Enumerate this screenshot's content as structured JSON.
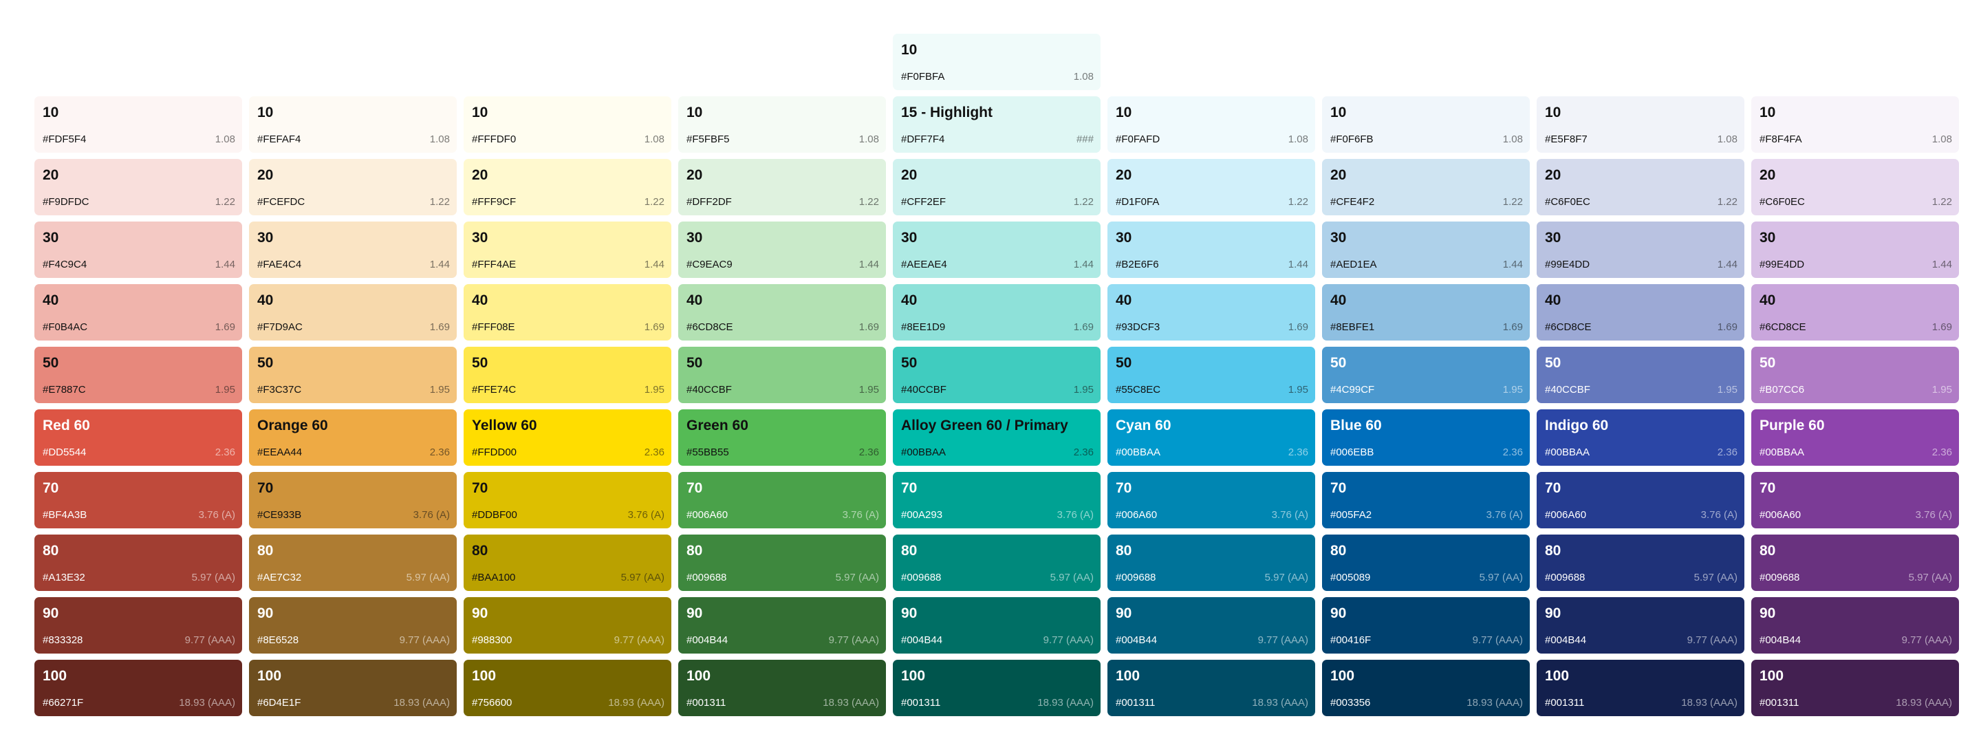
{
  "columns": [
    {
      "name": "red",
      "swatches": [
        {
          "label": "10",
          "hex": "#FDF5F4",
          "contrast": "1.08",
          "fill": "#FDF5F4"
        },
        {
          "label": "20",
          "hex": "#F9DFDC",
          "contrast": "1.22",
          "fill": "#F9DFDC"
        },
        {
          "label": "30",
          "hex": "#F4C9C4",
          "contrast": "1.44",
          "fill": "#F4C9C4"
        },
        {
          "label": "40",
          "hex": "#F0B4AC",
          "contrast": "1.69",
          "fill": "#F0B4AC"
        },
        {
          "label": "50",
          "hex": "#E7887C",
          "contrast": "1.95",
          "fill": "#E7887C"
        },
        {
          "label": "Red 60",
          "hex": "#DD5544",
          "contrast": "2.36",
          "fill": "#DD5544"
        },
        {
          "label": "70",
          "hex": "#BF4A3B",
          "contrast": "3.76 (A)",
          "fill": "#BF4A3B"
        },
        {
          "label": "80",
          "hex": "#A13E32",
          "contrast": "5.97 (AA)",
          "fill": "#A13E32"
        },
        {
          "label": "90",
          "hex": "#833328",
          "contrast": "9.77 (AAA)",
          "fill": "#833328"
        },
        {
          "label": "100",
          "hex": "#66271F",
          "contrast": "18.93 (AAA)",
          "fill": "#66271F"
        }
      ]
    },
    {
      "name": "orange",
      "swatches": [
        {
          "label": "10",
          "hex": "#FEFAF4",
          "contrast": "1.08",
          "fill": "#FEFAF4"
        },
        {
          "label": "20",
          "hex": "#FCEFDC",
          "contrast": "1.22",
          "fill": "#FCEFDC"
        },
        {
          "label": "30",
          "hex": "#FAE4C4",
          "contrast": "1.44",
          "fill": "#FAE4C4"
        },
        {
          "label": "40",
          "hex": "#F7D9AC",
          "contrast": "1.69",
          "fill": "#F7D9AC"
        },
        {
          "label": "50",
          "hex": "#F3C37C",
          "contrast": "1.95",
          "fill": "#F3C37C"
        },
        {
          "label": "Orange 60",
          "hex": "#EEAA44",
          "contrast": "2.36",
          "fill": "#EEAA44"
        },
        {
          "label": "70",
          "hex": "#CE933B",
          "contrast": "3.76 (A)",
          "fill": "#CE933B"
        },
        {
          "label": "80",
          "hex": "#AE7C32",
          "contrast": "5.97 (AA)",
          "fill": "#AE7C32"
        },
        {
          "label": "90",
          "hex": "#8E6528",
          "contrast": "9.77 (AAA)",
          "fill": "#8E6528"
        },
        {
          "label": "100",
          "hex": "#6D4E1F",
          "contrast": "18.93 (AAA)",
          "fill": "#6D4E1F"
        }
      ]
    },
    {
      "name": "yellow",
      "swatches": [
        {
          "label": "10",
          "hex": "#FFFDF0",
          "contrast": "1.08",
          "fill": "#FFFDF0"
        },
        {
          "label": "20",
          "hex": "#FFF9CF",
          "contrast": "1.22",
          "fill": "#FFF9CF"
        },
        {
          "label": "30",
          "hex": "#FFF4AE",
          "contrast": "1.44",
          "fill": "#FFF4AE"
        },
        {
          "label": "40",
          "hex": "#FFF08E",
          "contrast": "1.69",
          "fill": "#FFF08E"
        },
        {
          "label": "50",
          "hex": "#FFE74C",
          "contrast": "1.95",
          "fill": "#FFE74C"
        },
        {
          "label": "Yellow 60",
          "hex": "#FFDD00",
          "contrast": "2.36",
          "fill": "#FFDD00"
        },
        {
          "label": "70",
          "hex": "#DDBF00",
          "contrast": "3.76 (A)",
          "fill": "#DDBF00"
        },
        {
          "label": "80",
          "hex": "#BAA100",
          "contrast": "5.97 (AA)",
          "fill": "#BAA100"
        },
        {
          "label": "90",
          "hex": "#988300",
          "contrast": "9.77 (AAA)",
          "fill": "#988300"
        },
        {
          "label": "100",
          "hex": "#756600",
          "contrast": "18.93 (AAA)",
          "fill": "#756600"
        }
      ]
    },
    {
      "name": "green",
      "swatches": [
        {
          "label": "10",
          "hex": "#F5FBF5",
          "contrast": "1.08",
          "fill": "#F5FBF5"
        },
        {
          "label": "20",
          "hex": "#DFF2DF",
          "contrast": "1.22",
          "fill": "#DFF2DF"
        },
        {
          "label": "30",
          "hex": "#C9EAC9",
          "contrast": "1.44",
          "fill": "#C9EAC9"
        },
        {
          "label": "40",
          "hex": "#6CD8CE",
          "contrast": "1.69",
          "fill": "#B3E1B3"
        },
        {
          "label": "50",
          "hex": "#40CCBF",
          "contrast": "1.95",
          "fill": "#88CF88"
        },
        {
          "label": "Green 60",
          "hex": "#55BB55",
          "contrast": "2.36",
          "fill": "#55BB55"
        },
        {
          "label": "70",
          "hex": "#006A60",
          "contrast": "3.76 (A)",
          "fill": "#4AA24A"
        },
        {
          "label": "80",
          "hex": "#009688",
          "contrast": "5.97 (AA)",
          "fill": "#3E883E"
        },
        {
          "label": "90",
          "hex": "#004B44",
          "contrast": "9.77 (AAA)",
          "fill": "#336F33"
        },
        {
          "label": "100",
          "hex": "#001311",
          "contrast": "18.93 (AAA)",
          "fill": "#275527"
        }
      ]
    },
    {
      "name": "alloy-green",
      "top": {
        "label": "10",
        "hex": "#F0FBFA",
        "contrast": "1.08",
        "fill": "#F0FBFA"
      },
      "swatches": [
        {
          "label": "15 - Highlight",
          "hex": "#DFF7F4",
          "contrast": "###",
          "fill": "#DFF7F4"
        },
        {
          "label": "20",
          "hex": "#CFF2EF",
          "contrast": "1.22",
          "fill": "#CFF2EF"
        },
        {
          "label": "30",
          "hex": "#AEEAE4",
          "contrast": "1.44",
          "fill": "#AEEAE4"
        },
        {
          "label": "40",
          "hex": "#8EE1D9",
          "contrast": "1.69",
          "fill": "#8EE1D9"
        },
        {
          "label": "50",
          "hex": "#40CCBF",
          "contrast": "1.95",
          "fill": "#40CCBF"
        },
        {
          "label": "Alloy Green 60 / Primary",
          "hex": "#00BBAA",
          "contrast": "2.36",
          "fill": "#00BBAA"
        },
        {
          "label": "70",
          "hex": "#00A293",
          "contrast": "3.76 (A)",
          "fill": "#00A293"
        },
        {
          "label": "80",
          "hex": "#009688",
          "contrast": "5.97 (AA)",
          "fill": "#00897C"
        },
        {
          "label": "90",
          "hex": "#004B44",
          "contrast": "9.77 (AAA)",
          "fill": "#006F65"
        },
        {
          "label": "100",
          "hex": "#001311",
          "contrast": "18.93 (AAA)",
          "fill": "#00554D"
        }
      ]
    },
    {
      "name": "cyan",
      "swatches": [
        {
          "label": "10",
          "hex": "#F0FAFD",
          "contrast": "1.08",
          "fill": "#F0FAFD"
        },
        {
          "label": "20",
          "hex": "#D1F0FA",
          "contrast": "1.22",
          "fill": "#D1F0FA"
        },
        {
          "label": "30",
          "hex": "#B2E6F6",
          "contrast": "1.44",
          "fill": "#B2E6F6"
        },
        {
          "label": "40",
          "hex": "#93DCF3",
          "contrast": "1.69",
          "fill": "#93DCF3"
        },
        {
          "label": "50",
          "hex": "#55C8EC",
          "contrast": "1.95",
          "fill": "#55C8EC"
        },
        {
          "label": "Cyan 60",
          "hex": "#00BBAA",
          "contrast": "2.36",
          "fill": "#0099CC"
        },
        {
          "label": "70",
          "hex": "#006A60",
          "contrast": "3.76 (A)",
          "fill": "#0086B2"
        },
        {
          "label": "80",
          "hex": "#009688",
          "contrast": "5.97 (AA)",
          "fill": "#007399"
        },
        {
          "label": "90",
          "hex": "#004B44",
          "contrast": "9.77 (AAA)",
          "fill": "#005F7F"
        },
        {
          "label": "100",
          "hex": "#001311",
          "contrast": "18.93 (AAA)",
          "fill": "#004C66"
        }
      ]
    },
    {
      "name": "blue",
      "swatches": [
        {
          "label": "10",
          "hex": "#F0F6FB",
          "contrast": "1.08",
          "fill": "#F0F6FB"
        },
        {
          "label": "20",
          "hex": "#CFE4F2",
          "contrast": "1.22",
          "fill": "#CFE4F2"
        },
        {
          "label": "30",
          "hex": "#AED1EA",
          "contrast": "1.44",
          "fill": "#AED1EA"
        },
        {
          "label": "40",
          "hex": "#8EBFE1",
          "contrast": "1.69",
          "fill": "#8EBFE1"
        },
        {
          "label": "50",
          "hex": "#4C99CF",
          "contrast": "1.95",
          "fill": "#4C99CF"
        },
        {
          "label": "Blue 60",
          "hex": "#006EBB",
          "contrast": "2.36",
          "fill": "#006EBB"
        },
        {
          "label": "70",
          "hex": "#005FA2",
          "contrast": "3.76 (A)",
          "fill": "#005FA2"
        },
        {
          "label": "80",
          "hex": "#005089",
          "contrast": "5.97 (AA)",
          "fill": "#005089"
        },
        {
          "label": "90",
          "hex": "#00416F",
          "contrast": "9.77 (AAA)",
          "fill": "#00416F"
        },
        {
          "label": "100",
          "hex": "#003356",
          "contrast": "18.93 (AAA)",
          "fill": "#003356"
        }
      ]
    },
    {
      "name": "indigo",
      "swatches": [
        {
          "label": "10",
          "hex": "#E5F8F7",
          "contrast": "1.08",
          "fill": "#F1F3F9"
        },
        {
          "label": "20",
          "hex": "#C6F0EC",
          "contrast": "1.22",
          "fill": "#D5DBED"
        },
        {
          "label": "30",
          "hex": "#99E4DD",
          "contrast": "1.44",
          "fill": "#B9C2E1"
        },
        {
          "label": "40",
          "hex": "#6CD8CE",
          "contrast": "1.69",
          "fill": "#9CA9D5"
        },
        {
          "label": "50",
          "hex": "#40CCBF",
          "contrast": "1.95",
          "fill": "#6478BD"
        },
        {
          "label": "Indigo 60",
          "hex": "#00BBAA",
          "contrast": "2.36",
          "fill": "#2B46A6"
        },
        {
          "label": "70",
          "hex": "#006A60",
          "contrast": "3.76 (A)",
          "fill": "#253C90"
        },
        {
          "label": "80",
          "hex": "#009688",
          "contrast": "5.97 (AA)",
          "fill": "#1F3279"
        },
        {
          "label": "90",
          "hex": "#004B44",
          "contrast": "9.77 (AAA)",
          "fill": "#192963"
        },
        {
          "label": "100",
          "hex": "#001311",
          "contrast": "18.93 (AAA)",
          "fill": "#13204D"
        }
      ]
    },
    {
      "name": "purple",
      "swatches": [
        {
          "label": "10",
          "hex": "#F8F4FA",
          "contrast": "1.08",
          "fill": "#F8F4FA"
        },
        {
          "label": "20",
          "hex": "#C6F0EC",
          "contrast": "1.22",
          "fill": "#E8DAF0"
        },
        {
          "label": "30",
          "hex": "#99E4DD",
          "contrast": "1.44",
          "fill": "#D8C0E6"
        },
        {
          "label": "40",
          "hex": "#6CD8CE",
          "contrast": "1.69",
          "fill": "#C9A6DC"
        },
        {
          "label": "50",
          "hex": "#B07CC6",
          "contrast": "1.95",
          "fill": "#B07CC6"
        },
        {
          "label": "Purple 60",
          "hex": "#00BBAA",
          "contrast": "2.36",
          "fill": "#8E44AD"
        },
        {
          "label": "70",
          "hex": "#006A60",
          "contrast": "3.76 (A)",
          "fill": "#7B3B96"
        },
        {
          "label": "80",
          "hex": "#009688",
          "contrast": "5.97 (AA)",
          "fill": "#69327F"
        },
        {
          "label": "90",
          "hex": "#004B44",
          "contrast": "9.77 (AAA)",
          "fill": "#562968"
        },
        {
          "label": "100",
          "hex": "#001311",
          "contrast": "18.93 (AAA)",
          "fill": "#432051"
        }
      ]
    }
  ]
}
